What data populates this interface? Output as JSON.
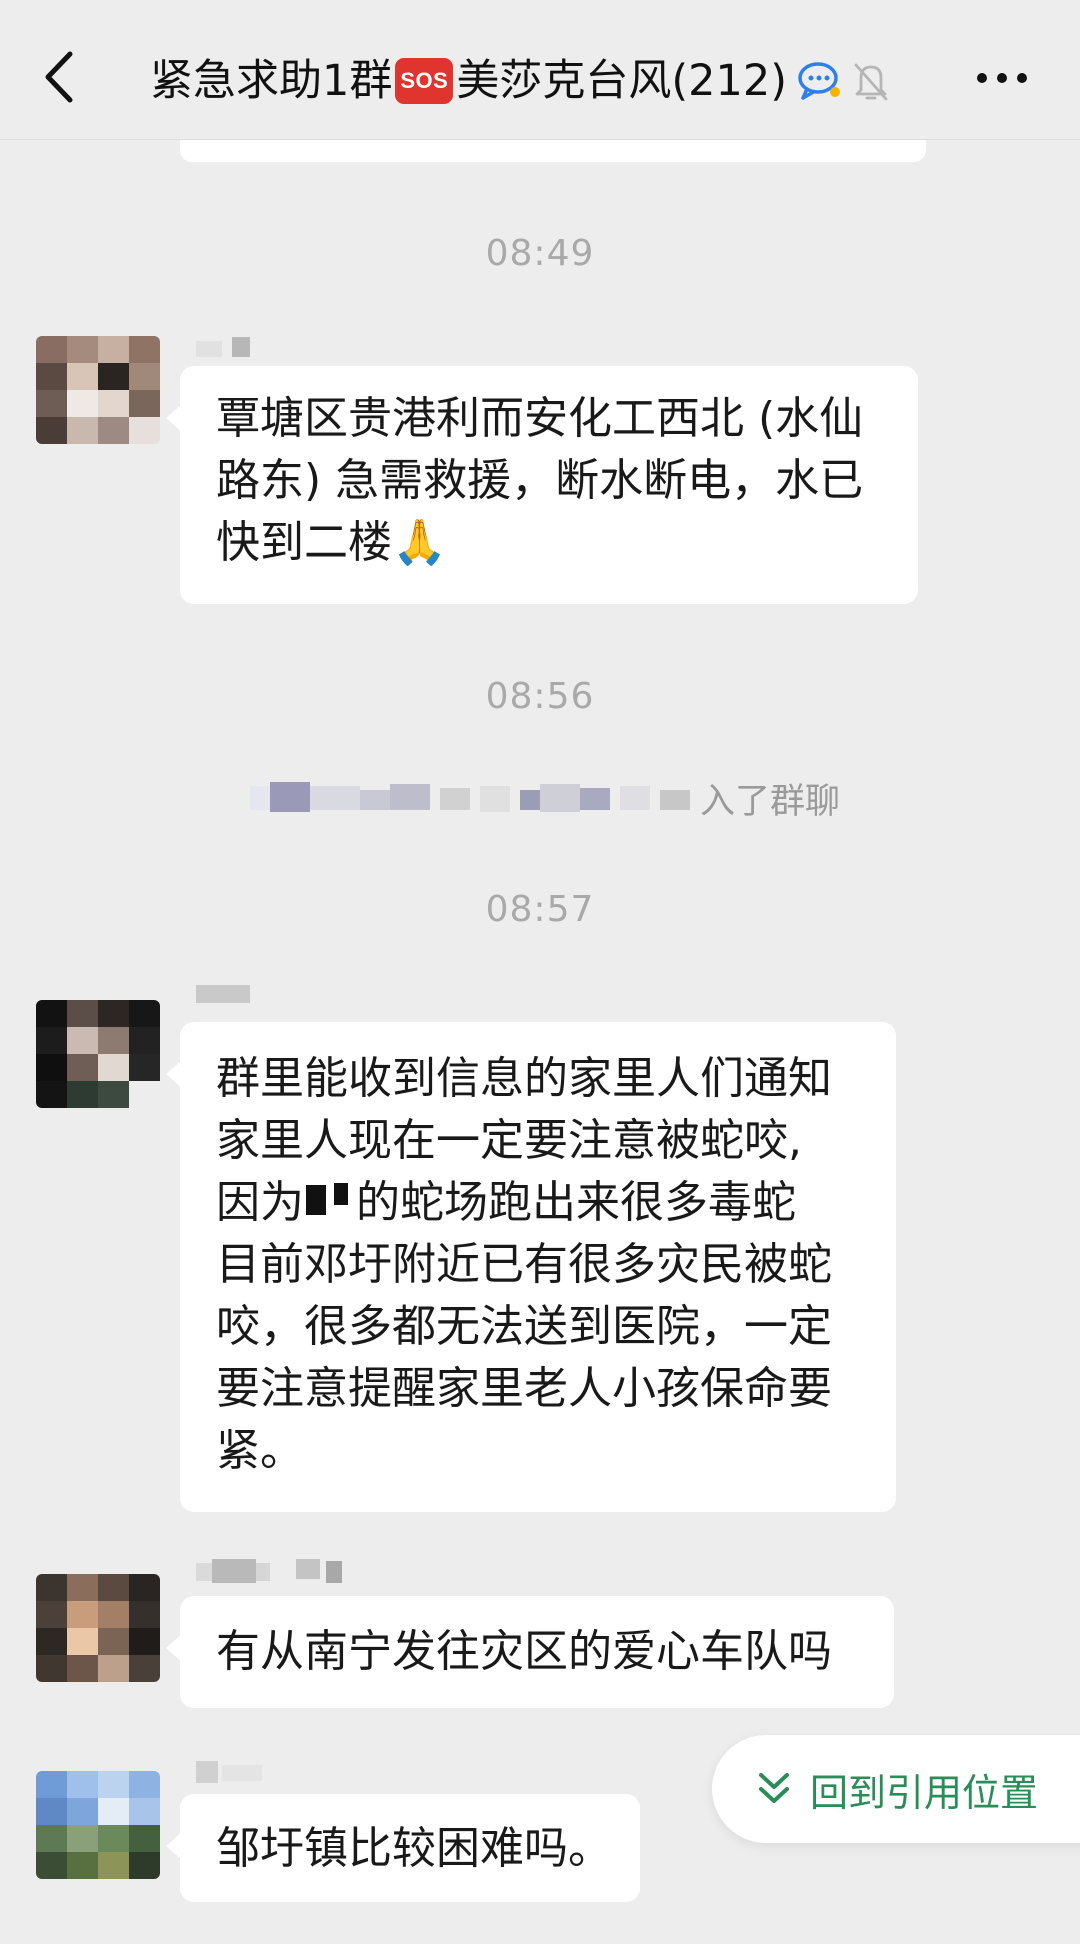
{
  "header": {
    "back_icon": "chevron-left-icon",
    "title_prefix": "紧急求助1群",
    "sos_label": "SOS",
    "title_suffix": "美莎克台风(212)",
    "chat_icon": "chat-bubble-icon",
    "mute_icon": "bell-off-icon",
    "more_icon": "more-dots-icon"
  },
  "messages": {
    "time_1": "08:49",
    "msg_1_lines": [
      "覃塘区贵港利而安化工西北 (水仙",
      "路东) 急需救援，断水断电，水已",
      "快到二楼"
    ],
    "msg_1_emoji": "🙏",
    "time_2": "08:56",
    "system_text": "入了群聊",
    "time_3": "08:57",
    "msg_2_lines": [
      "群里能收到信息的家里人们通知",
      "家里人现在一定要注意被蛇咬,",
      "因为",
      "的蛇场跑出来很多毒蛇",
      "目前邓圩附近已有很多灾民被蛇",
      "咬，很多都无法送到医院，一定",
      "要注意提醒家里老人小孩保命要",
      "紧。"
    ],
    "msg_3": "有从南宁发往灾区的爱心车队吗",
    "msg_4": "邹圩镇比较困难吗。"
  },
  "jump_button": {
    "label": "回到引用位置",
    "icon": "double-chevron-down-icon",
    "color": "#2a8c56"
  },
  "colors": {
    "background": "#ededed",
    "bubble": "#ffffff",
    "sos": "#e0342f",
    "timestamp": "#a9a9a9"
  }
}
